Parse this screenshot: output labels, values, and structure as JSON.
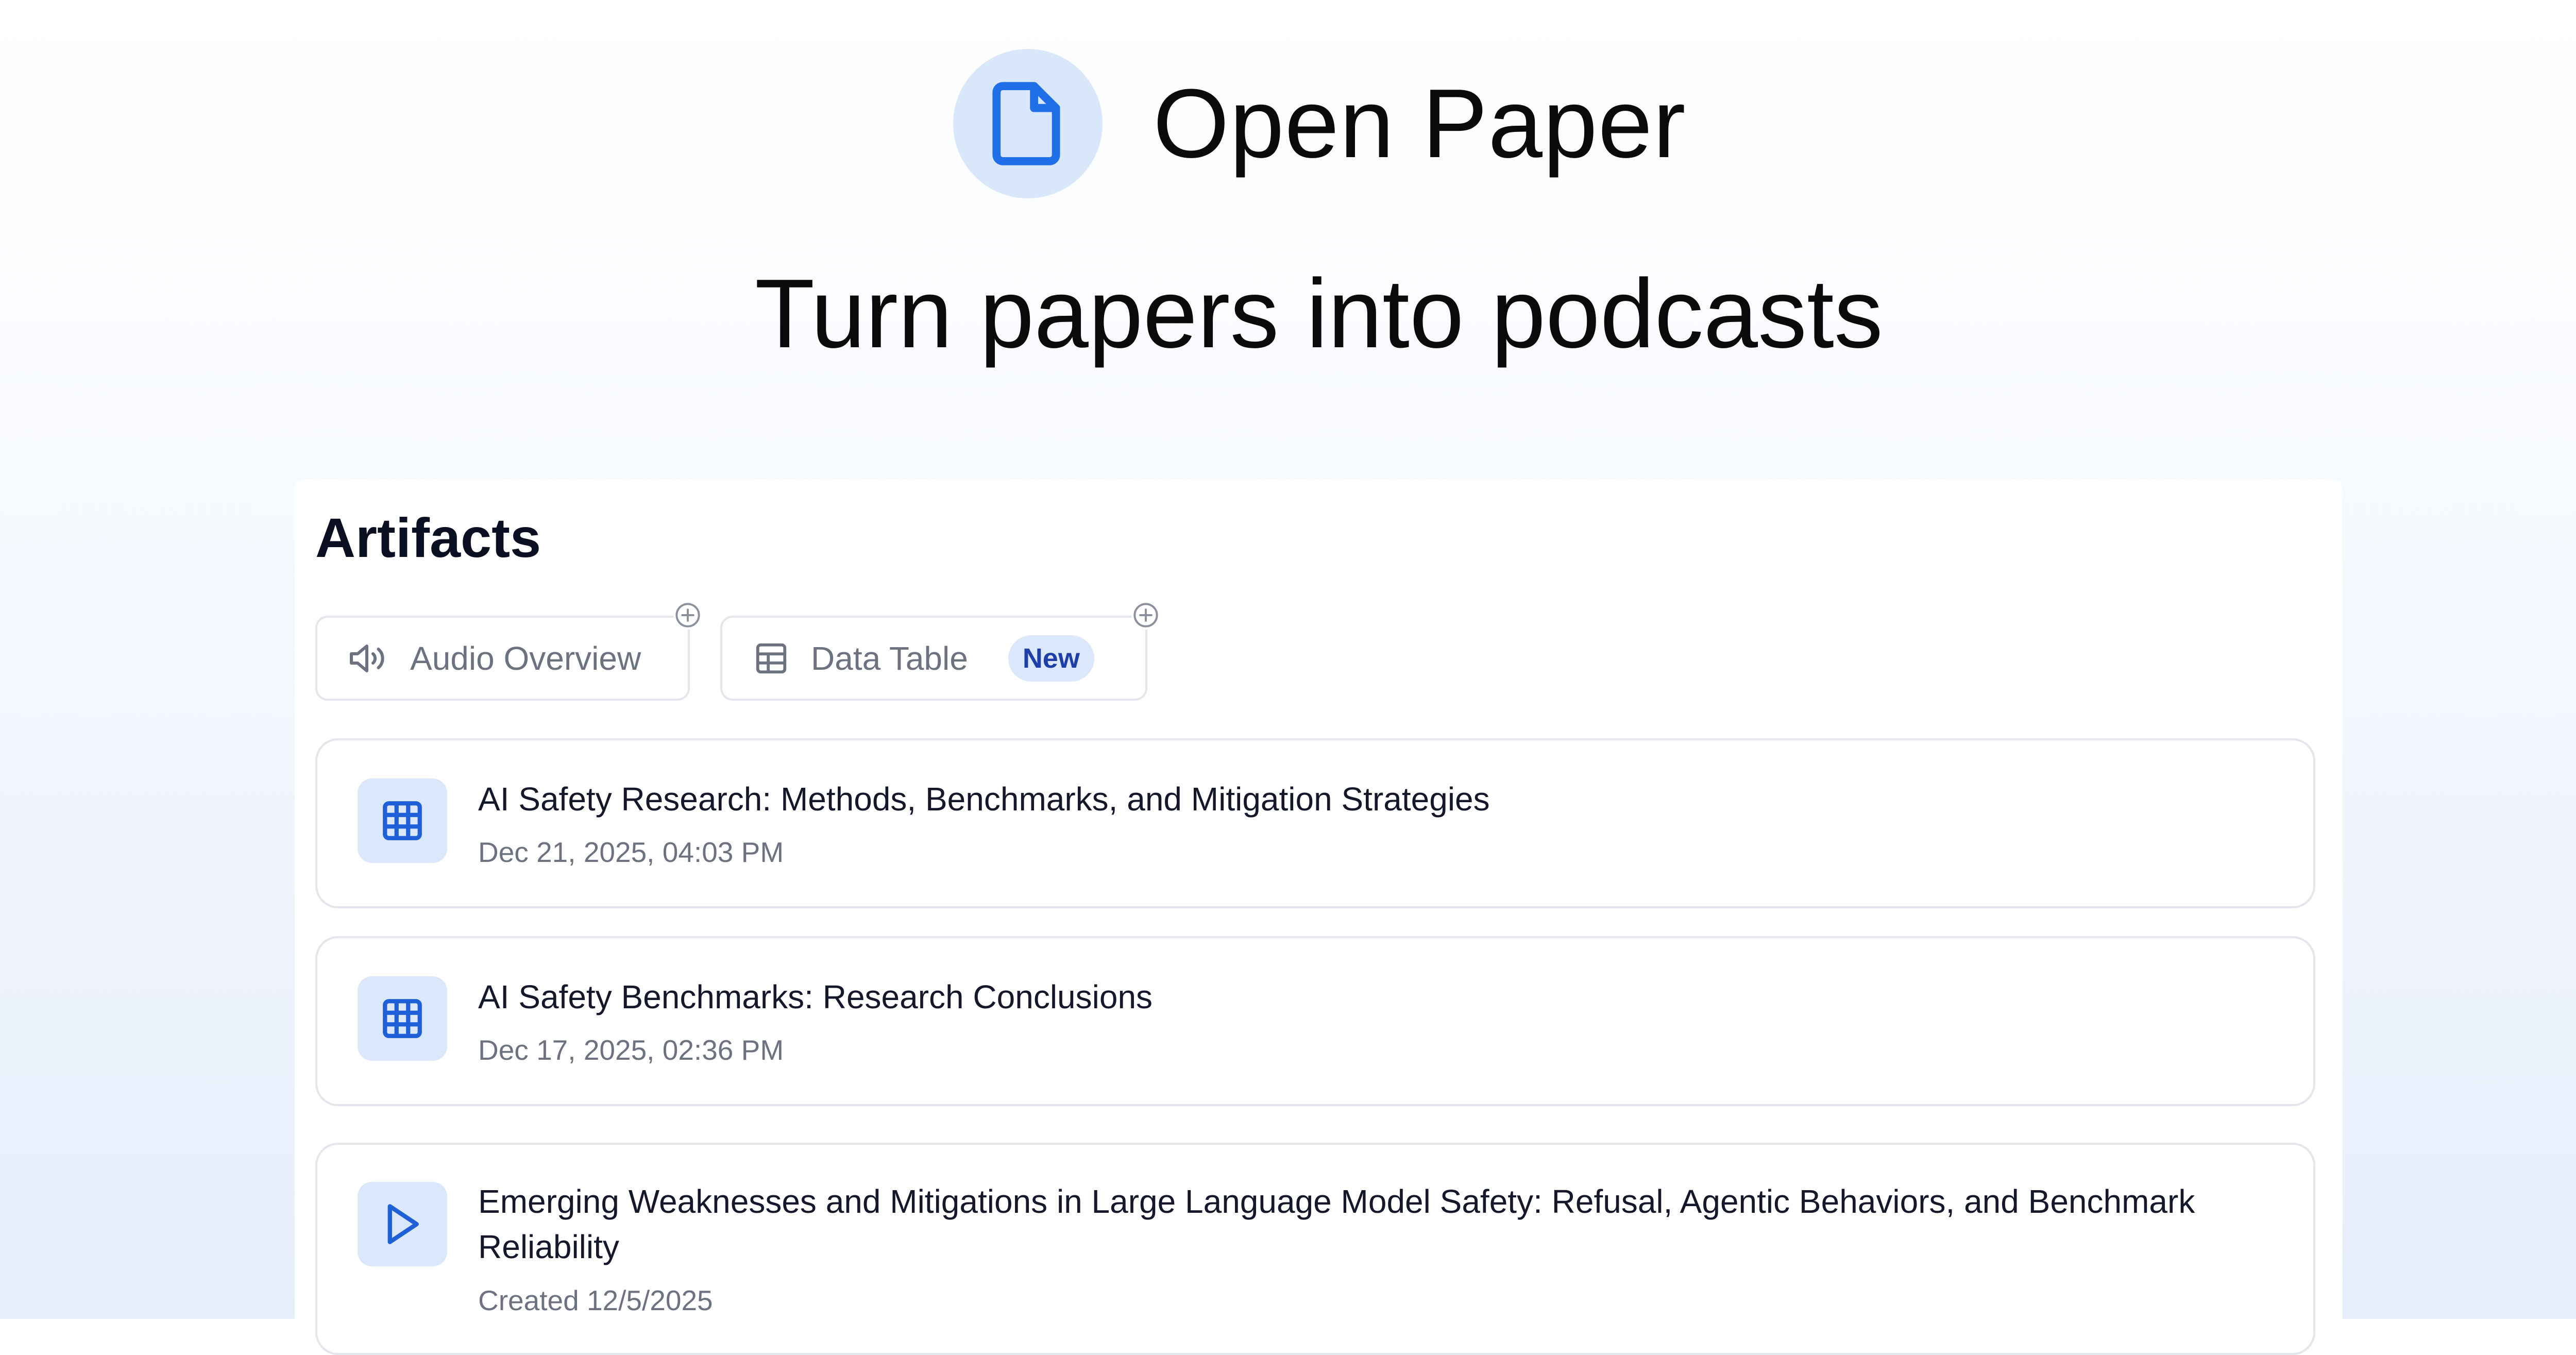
{
  "brand": {
    "name": "Open Paper",
    "icon": "document-icon"
  },
  "hero": {
    "tagline": "Turn papers into podcasts"
  },
  "artifacts": {
    "title": "Artifacts",
    "actions": [
      {
        "label": "Audio Overview",
        "icon": "speaker-icon",
        "add_icon": "plus-circle-icon"
      },
      {
        "label": "Data Table",
        "icon": "table-icon",
        "badge": "New",
        "add_icon": "plus-circle-icon"
      }
    ],
    "items": [
      {
        "title": "AI Safety Research: Methods, Benchmarks, and Mitigation Strategies",
        "subtitle": "Dec 21, 2025, 04:03 PM",
        "icon": "table-icon"
      },
      {
        "title": "AI Safety Benchmarks: Research Conclusions",
        "subtitle": "Dec 17, 2025, 02:36 PM",
        "icon": "table-icon"
      },
      {
        "title": "Emerging Weaknesses and Mitigations in Large Language Model Safety: Refusal, Agentic Behaviors, and Benchmark Reliability",
        "subtitle": "Created 12/5/2025",
        "icon": "play-icon"
      }
    ]
  },
  "colors": {
    "accent": "#1f5fd8",
    "icon_bg": "#dbe7fb",
    "badge_text": "#1f3fa8",
    "border": "#e3e6ec",
    "muted_text": "#6c7280"
  }
}
